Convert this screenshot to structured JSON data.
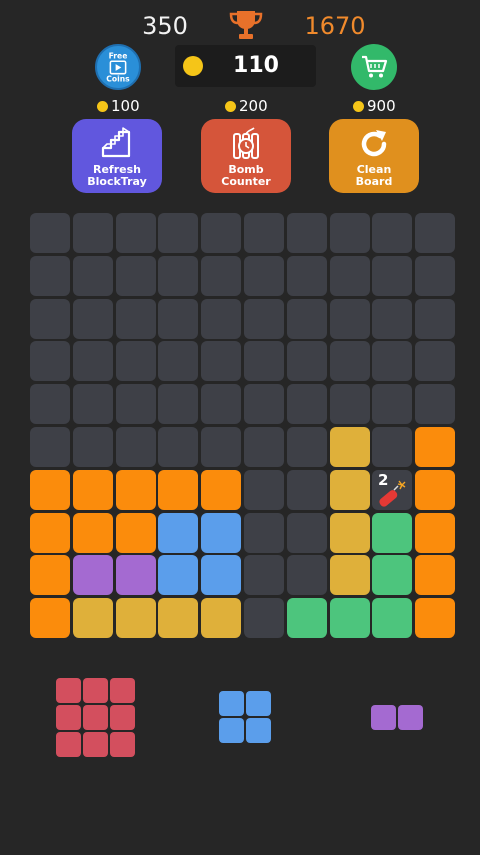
{
  "header": {
    "score": "350",
    "best_score": "1670",
    "coins": "110",
    "free_coins_label_1": "Free",
    "free_coins_label_2": "Coins"
  },
  "powerups": [
    {
      "name": "refresh-blocktray",
      "cost": "100",
      "label_1": "Refresh",
      "label_2": "BlockTray",
      "color": "#6157de",
      "icon": "tetromino-icon"
    },
    {
      "name": "bomb-counter",
      "cost": "200",
      "label_1": "Bomb",
      "label_2": "Counter",
      "color": "#d5553a",
      "icon": "dynamite-icon"
    },
    {
      "name": "clean-board",
      "cost": "900",
      "label_1": "Clean",
      "label_2": "Board",
      "color": "#e0901e",
      "icon": "refresh-arrow-icon"
    }
  ],
  "colors": {
    "E": "#3e4047",
    "O": "#fb8c0c",
    "Y": "#dfb03a",
    "G": "#4dc57d",
    "B": "#5b9eeb",
    "P": "#a46ad1",
    "R": "#d34f5e"
  },
  "board": [
    "EEEEEEEEEE",
    "EEEEEEEEEE",
    "EEEEEEEEEE",
    "EEEEEEEEEE",
    "EEEEEEEEEE",
    "EEEEEEEYEO",
    "OOOOOEEYXO",
    "OOOBBEEYGO",
    "OPPBBEEYGO",
    "OYYYYEGGGO"
  ],
  "bomb": {
    "counter": "2"
  },
  "tray": [
    {
      "name": "tray-piece-red",
      "color": "R",
      "rows": [
        "XXX",
        "XXX",
        "XXX"
      ]
    },
    {
      "name": "tray-piece-blue",
      "color": "B",
      "rows": [
        "XX",
        "XX"
      ]
    },
    {
      "name": "tray-piece-purple",
      "color": "P",
      "rows": [
        "XX"
      ]
    }
  ]
}
